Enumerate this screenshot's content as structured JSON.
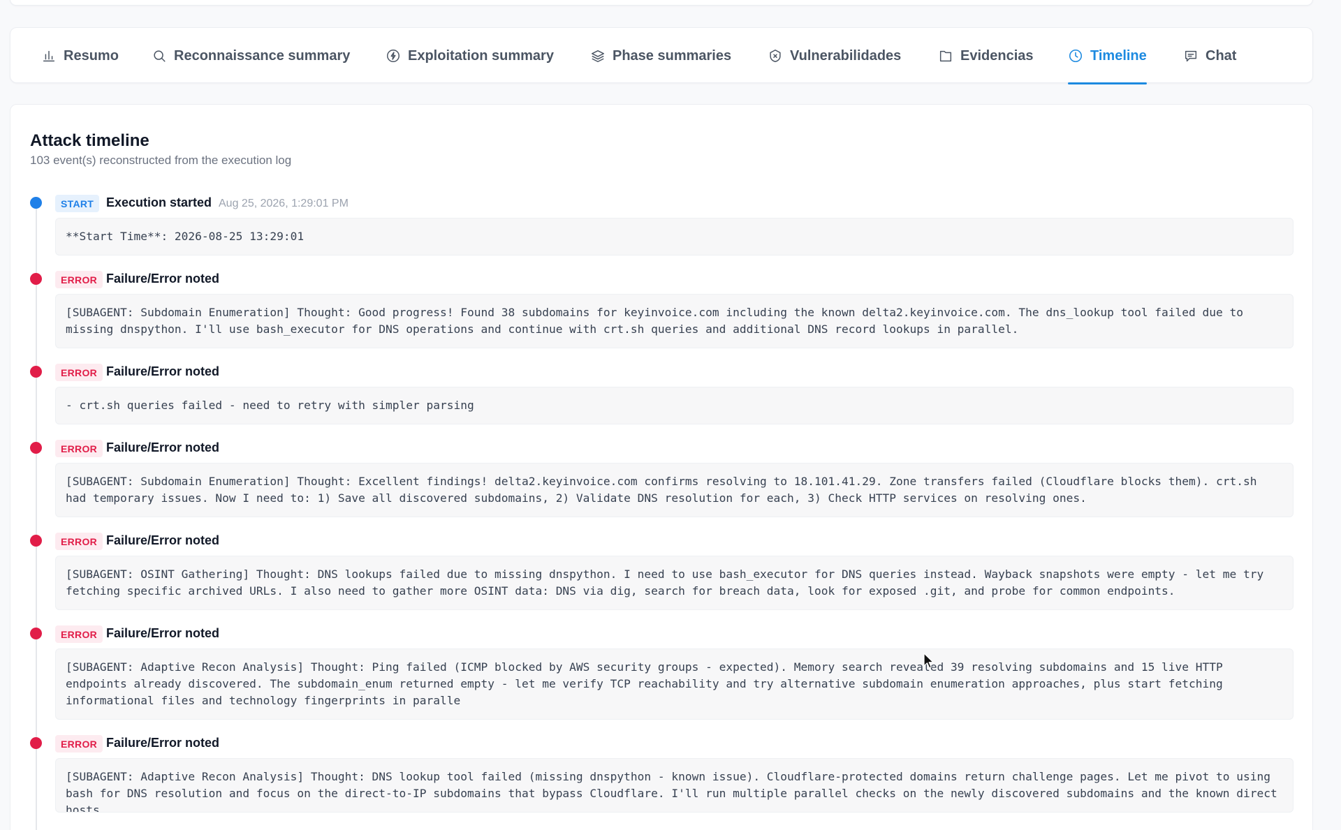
{
  "tabs": [
    {
      "label": "Resumo",
      "icon": "bar-chart-icon",
      "active": false
    },
    {
      "label": "Reconnaissance summary",
      "icon": "search-icon",
      "active": false
    },
    {
      "label": "Exploitation summary",
      "icon": "lightning-icon",
      "active": false
    },
    {
      "label": "Phase summaries",
      "icon": "layers-icon",
      "active": false
    },
    {
      "label": "Vulnerabilidades",
      "icon": "shield-x-icon",
      "active": false
    },
    {
      "label": "Evidencias",
      "icon": "folder-icon",
      "active": false
    },
    {
      "label": "Timeline",
      "icon": "clock-icon",
      "active": true
    },
    {
      "label": "Chat",
      "icon": "chat-icon",
      "active": false
    }
  ],
  "colors": {
    "accent": "#1d8ae0",
    "start": "#1f80e8",
    "error": "#e11d48"
  },
  "timeline": {
    "title": "Attack timeline",
    "subtitle": "103 event(s) reconstructed from the execution log",
    "events": [
      {
        "type": "start",
        "badge": "START",
        "title": "Execution started",
        "time": "Aug 25, 2026, 1:29:01 PM",
        "text": "**Start Time**: 2026-08-25 13:29:01"
      },
      {
        "type": "error",
        "badge": "ERROR",
        "title": "Failure/Error noted",
        "time": "",
        "text": "[SUBAGENT: Subdomain Enumeration] Thought: Good progress! Found 38 subdomains for keyinvoice.com including the known delta2.keyinvoice.com. The dns_lookup tool failed due to missing dnspython. I'll use bash_executor for DNS operations and continue with crt.sh queries and additional DNS record lookups in parallel."
      },
      {
        "type": "error",
        "badge": "ERROR",
        "title": "Failure/Error noted",
        "time": "",
        "text": "- crt.sh queries failed - need to retry with simpler parsing"
      },
      {
        "type": "error",
        "badge": "ERROR",
        "title": "Failure/Error noted",
        "time": "",
        "text": "[SUBAGENT: Subdomain Enumeration] Thought: Excellent findings! delta2.keyinvoice.com confirms resolving to 18.101.41.29. Zone transfers failed (Cloudflare blocks them). crt.sh had temporary issues. Now I need to: 1) Save all discovered subdomains, 2) Validate DNS resolution for each, 3) Check HTTP services on resolving ones."
      },
      {
        "type": "error",
        "badge": "ERROR",
        "title": "Failure/Error noted",
        "time": "",
        "text": "[SUBAGENT: OSINT Gathering] Thought: DNS lookups failed due to missing dnspython. I need to use bash_executor for DNS queries instead. Wayback snapshots were empty - let me try fetching specific archived URLs. I also need to gather more OSINT data: DNS via dig, search for breach data, look for exposed .git, and probe for common endpoints."
      },
      {
        "type": "error",
        "badge": "ERROR",
        "title": "Failure/Error noted",
        "time": "",
        "text": "[SUBAGENT: Adaptive Recon Analysis] Thought: Ping failed (ICMP blocked by AWS security groups - expected). Memory search revealed 39 resolving subdomains and 15 live HTTP endpoints already discovered. The subdomain_enum returned empty - let me verify TCP reachability and try alternative subdomain enumeration approaches, plus start fetching informational files and technology fingerprints in paralle"
      },
      {
        "type": "error",
        "badge": "ERROR",
        "title": "Failure/Error noted",
        "time": "",
        "text": "[SUBAGENT: Adaptive Recon Analysis] Thought: DNS lookup tool failed (missing dnspython - known issue). Cloudflare-protected domains return challenge pages. Let me pivot to using bash for DNS resolution and focus on the direct-to-IP subdomains that bypass Cloudflare. I'll run multiple parallel checks on the newly discovered subdomains and the known direct hosts."
      }
    ]
  }
}
